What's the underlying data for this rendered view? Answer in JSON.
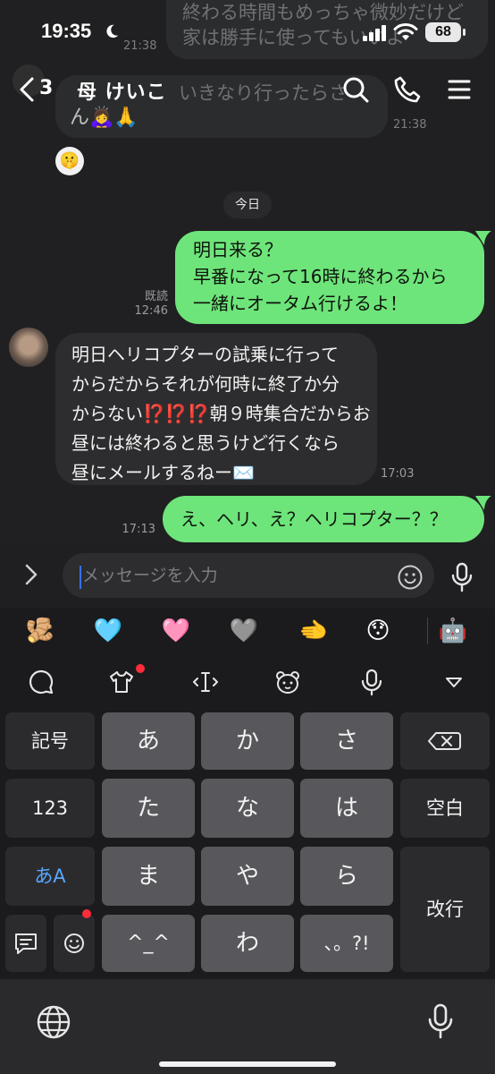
{
  "status_bar": {
    "time": "19:35",
    "battery": "68"
  },
  "header": {
    "unread_count": "3",
    "title": "母 けいこ"
  },
  "background_messages": {
    "top_text_lines": [
      "終わる時間もめっちゃ微妙だけど",
      "家は勝手に使ってもいいよ"
    ],
    "top_time": "21:38",
    "prev_text": "いきなり行ったらさ",
    "prev_emoji": "ん🙇‍♀️🙏",
    "prev_time": "21:38",
    "sticker": "🤫"
  },
  "date_separator": "今日",
  "messages": [
    {
      "direction": "out",
      "lines": [
        "明日来る？",
        "早番になって16時に終わるから",
        "一緒にオータム行けるよ！"
      ],
      "read_label": "既読",
      "time": "12:46"
    },
    {
      "direction": "in",
      "lines": [
        "明日ヘリコプターの試乗に行って",
        "からだからそれが何時に終了か分",
        "からない⁉️⁉️⁉️朝９時集合だからお",
        "昼には終わると思うけど行くなら",
        "昼にメールするねー✉️"
      ],
      "time": "17:03"
    },
    {
      "direction": "out",
      "lines": [
        "え、ヘリ、え？ヘリコプター？？"
      ],
      "time": "17:13"
    }
  ],
  "input": {
    "placeholder": "メッセージを入力"
  },
  "emoji_suggestions": [
    "🫚",
    "🩵",
    "🩷",
    "🩶",
    "🫲",
    "😯",
    "🤖"
  ],
  "keyboard": {
    "left_keys": [
      "記号",
      "123",
      "あA"
    ],
    "main_rows": [
      [
        "あ",
        "か",
        "さ"
      ],
      [
        "た",
        "な",
        "は"
      ],
      [
        "ま",
        "や",
        "ら"
      ],
      [
        "^_^",
        "わ",
        "、。?!"
      ]
    ],
    "right_keys": [
      "空白",
      "改行"
    ]
  },
  "colors": {
    "accent": "#6ee57a",
    "incoming": "#2d2d2f",
    "caret": "#3b6ff0",
    "badge": "#ff2d3b"
  }
}
